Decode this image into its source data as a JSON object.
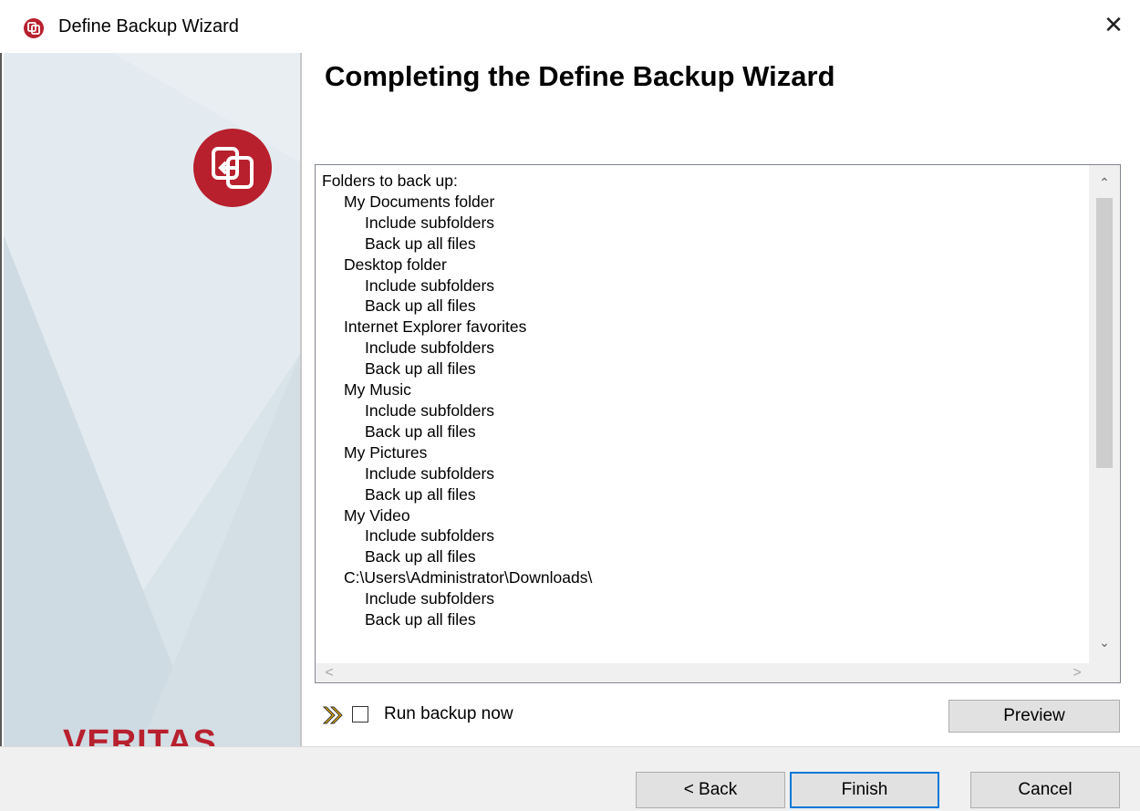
{
  "window": {
    "title": "Define Backup Wizard",
    "close_glyph": "✕"
  },
  "side_panel": {
    "brand": "VERITAS",
    "logo_icon": "backup-arrow-icon"
  },
  "heading": "Completing the Define Backup Wizard",
  "summary": {
    "lines": [
      {
        "text": "Folders to back up:",
        "level": 0
      },
      {
        "text": "My Documents folder",
        "level": 1
      },
      {
        "text": "Include subfolders",
        "level": 2
      },
      {
        "text": "Back up all files",
        "level": 2
      },
      {
        "text": "Desktop folder",
        "level": 1
      },
      {
        "text": "Include subfolders",
        "level": 2
      },
      {
        "text": "Back up all files",
        "level": 2
      },
      {
        "text": "Internet Explorer favorites",
        "level": 1
      },
      {
        "text": "Include subfolders",
        "level": 2
      },
      {
        "text": "Back up all files",
        "level": 2
      },
      {
        "text": "My Music",
        "level": 1
      },
      {
        "text": "Include subfolders",
        "level": 2
      },
      {
        "text": "Back up all files",
        "level": 2
      },
      {
        "text": "My Pictures",
        "level": 1
      },
      {
        "text": "Include subfolders",
        "level": 2
      },
      {
        "text": "Back up all files",
        "level": 2
      },
      {
        "text": "My Video",
        "level": 1
      },
      {
        "text": "Include subfolders",
        "level": 2
      },
      {
        "text": "Back up all files",
        "level": 2
      },
      {
        "text": "C:\\Users\\Administrator\\Downloads\\",
        "level": 1
      },
      {
        "text": "Include subfolders",
        "level": 2
      },
      {
        "text": "Back up all files",
        "level": 2
      }
    ]
  },
  "options": {
    "run_backup_now_label": "Run backup now",
    "run_backup_now_checked": false,
    "preview_label": "Preview"
  },
  "footer": {
    "back_label": "< Back",
    "finish_label": "Finish",
    "cancel_label": "Cancel"
  },
  "colors": {
    "brand_red": "#b8202e",
    "focus_blue": "#0078d7"
  }
}
